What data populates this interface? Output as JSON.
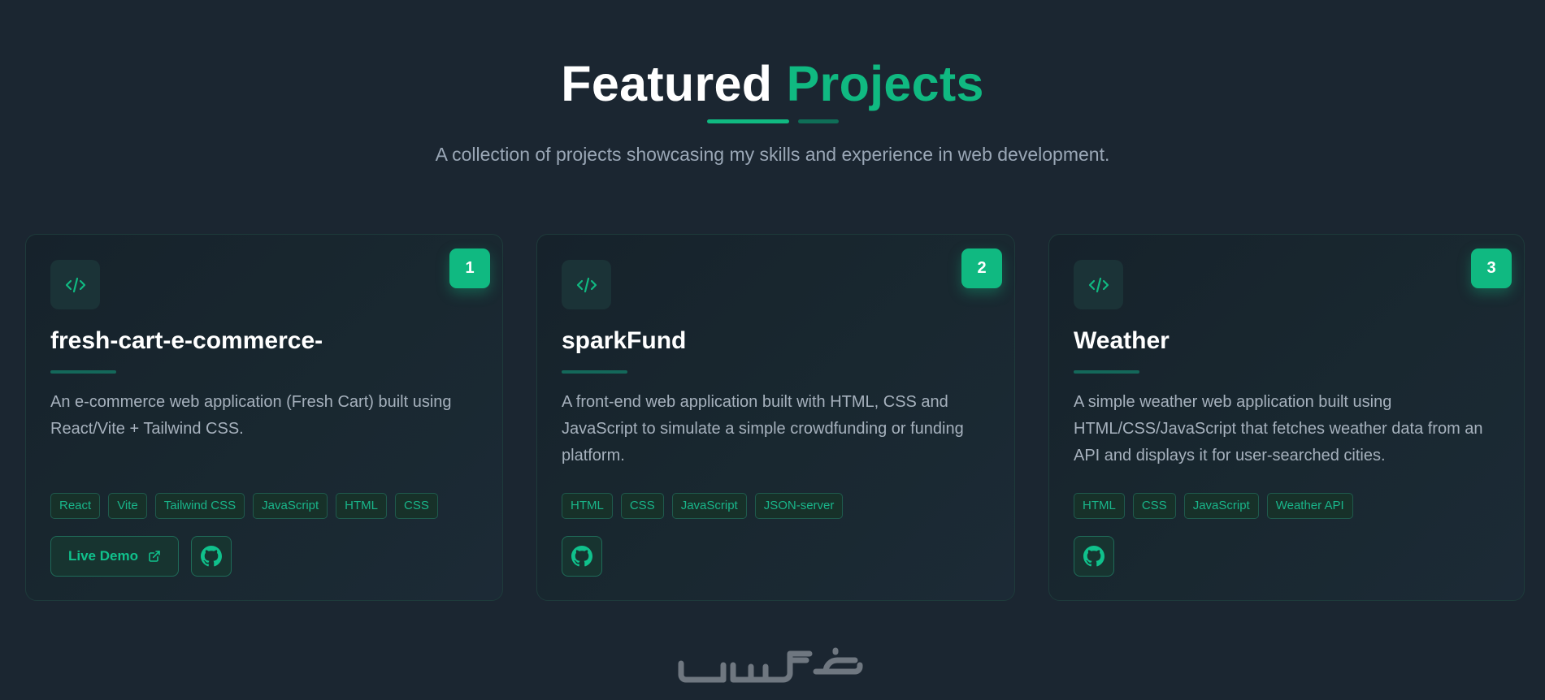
{
  "header": {
    "title_white": "Featured",
    "title_accent": "Projects",
    "subtitle": "A collection of projects showcasing my skills and experience in web development."
  },
  "projects": [
    {
      "number": "1",
      "title": "fresh-cart-e-commerce-",
      "description": "An e-commerce web application (Fresh Cart) built using React/Vite + Tailwind CSS.",
      "tags": [
        "React",
        "Vite",
        "Tailwind CSS",
        "JavaScript",
        "HTML",
        "CSS"
      ],
      "live_demo_label": "Live Demo"
    },
    {
      "number": "2",
      "title": "sparkFund",
      "description": "A front-end web application built with HTML, CSS and JavaScript to simulate a simple crowdfunding or funding platform.",
      "tags": [
        "HTML",
        "CSS",
        "JavaScript",
        "JSON-server"
      ]
    },
    {
      "number": "3",
      "title": "Weather",
      "description": "A simple weather web application built using HTML/CSS/JavaScript that fetches weather data from an API and displays it for user-searched cities.",
      "tags": [
        "HTML",
        "CSS",
        "JavaScript",
        "Weather API"
      ]
    }
  ],
  "watermark": {
    "text": "خمسات"
  },
  "colors": {
    "background": "#1b2631",
    "accent": "#10b981",
    "card_border": "#1e3b3b",
    "text_muted": "#a6b1bd"
  },
  "icons": {
    "code": "code-icon",
    "external_link": "external-link-icon",
    "github": "github-icon"
  }
}
